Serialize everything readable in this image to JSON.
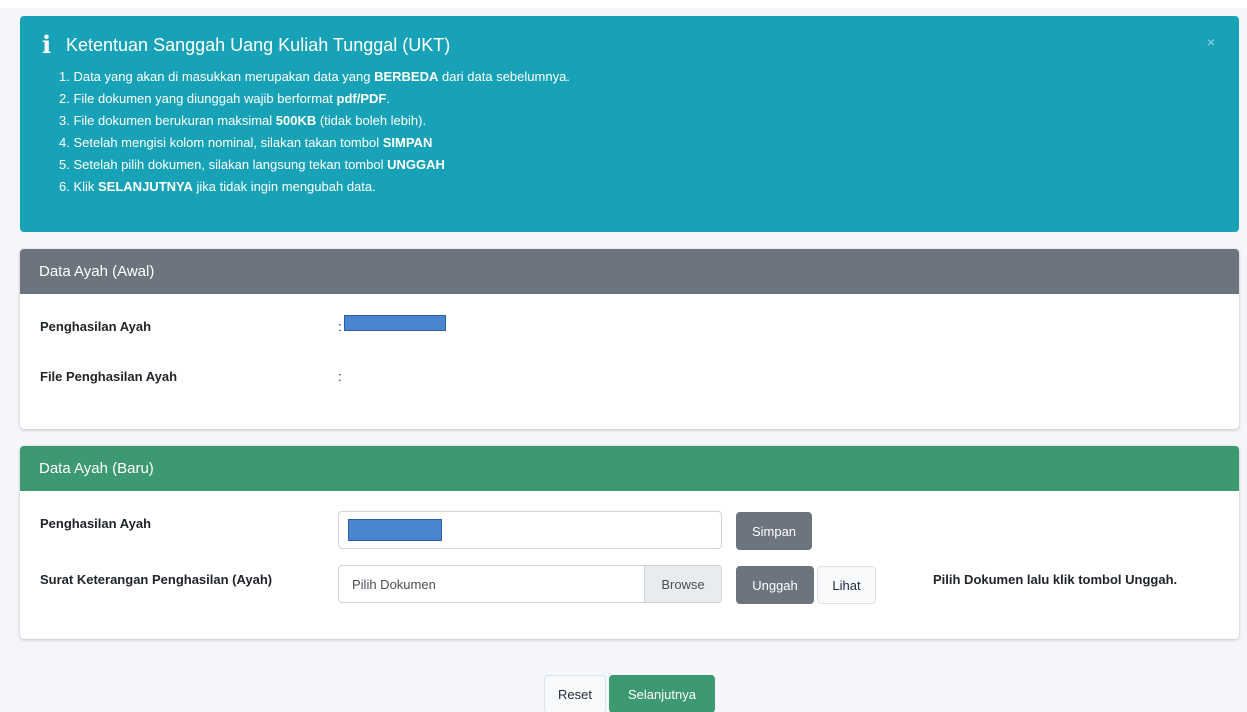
{
  "alert": {
    "icon": "info-icon",
    "title": "Ketentuan Sanggah Uang Kuliah Tunggal (UKT)",
    "close_label": "×",
    "rules": [
      {
        "pre": "1. Data yang akan di masukkan merupakan data yang ",
        "bold": "BERBEDA",
        "post": " dari data sebelumnya."
      },
      {
        "pre": "2. File dokumen yang diunggah wajib berformat ",
        "bold": "pdf/PDF",
        "post": "."
      },
      {
        "pre": "3. File dokumen berukuran maksimal ",
        "bold": "500KB",
        "post": " (tidak boleh lebih)."
      },
      {
        "pre": "4. Setelah mengisi kolom nominal, silakan takan tombol ",
        "bold": "SIMPAN",
        "post": ""
      },
      {
        "pre": "5. Setelah pilih dokumen, silakan langsung tekan tombol ",
        "bold": "UNGGAH",
        "post": ""
      },
      {
        "pre": "6. Klik ",
        "bold": "SELANJUTNYA",
        "post": " jika tidak ingin mengubah data."
      }
    ]
  },
  "awal": {
    "header": "Data Ayah (Awal)",
    "income_label": "Penghasilan Ayah",
    "income_colon": ":",
    "file_label": "File Penghasilan Ayah",
    "file_colon": ":"
  },
  "baru": {
    "header": "Data Ayah (Baru)",
    "income_label": "Penghasilan Ayah",
    "save_button": "Simpan",
    "doc_label": "Surat Keterangan Penghasilan (Ayah)",
    "file_placeholder": "Pilih Dokumen",
    "browse_label": "Browse",
    "upload_button": "Unggah",
    "view_button": "Lihat",
    "hint": "Pilih Dokumen lalu klik tombol Unggah."
  },
  "footer": {
    "reset_button": "Reset",
    "next_button": "Selanjutnya"
  },
  "colors": {
    "alert_bg": "#17a2b8",
    "awal_header_bg": "#6c757d",
    "baru_header_bg": "#3d9970",
    "redaction": "#4a86d0"
  }
}
